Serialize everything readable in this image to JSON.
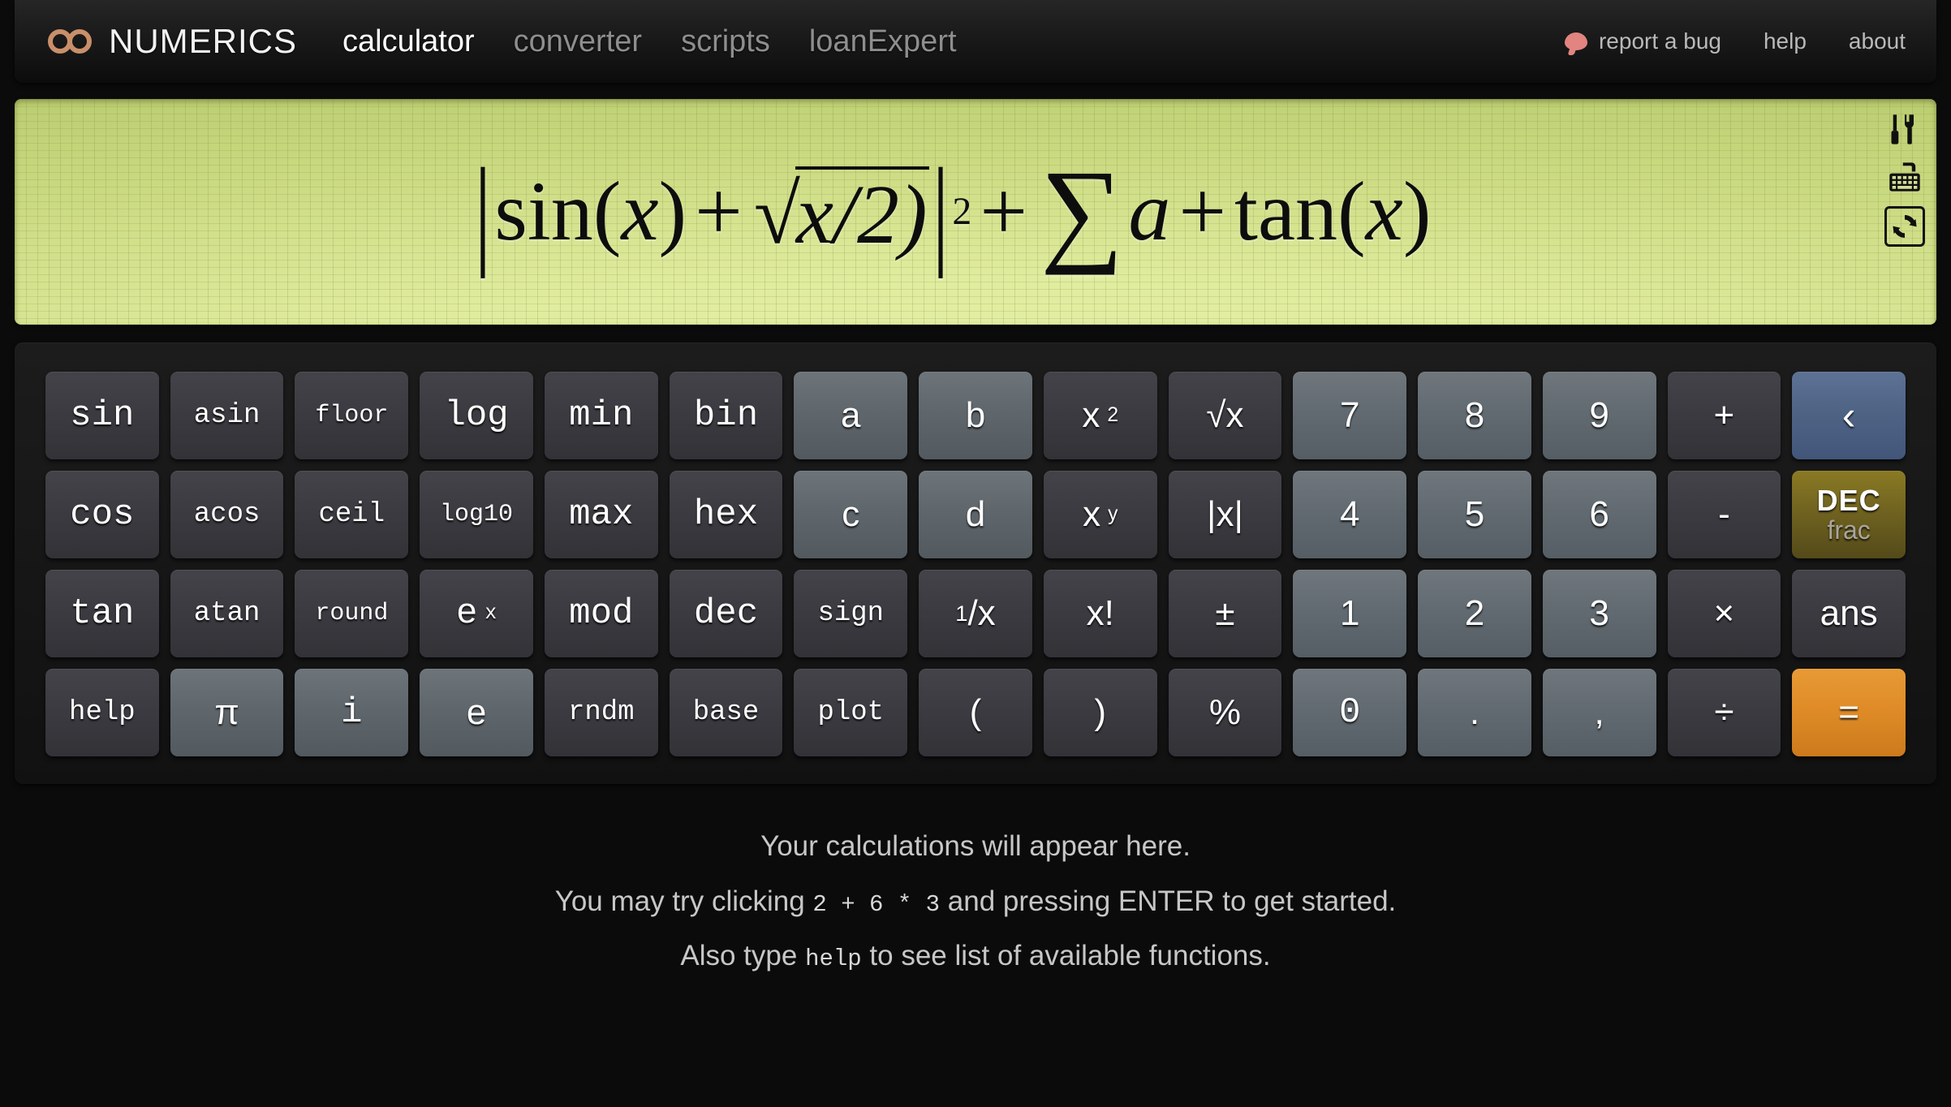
{
  "header": {
    "brand": "NUMERICS",
    "brand_icon": "infinity-icon",
    "brand_color": "#c98f6a",
    "nav": [
      {
        "label": "calculator",
        "active": true
      },
      {
        "label": "converter",
        "active": false
      },
      {
        "label": "scripts",
        "active": false
      },
      {
        "label": "loanExpert",
        "active": false
      }
    ],
    "util": [
      {
        "label": "report a bug",
        "icon": "speech-bubble-icon",
        "icon_color": "#e2847f"
      },
      {
        "label": "help",
        "icon": null
      },
      {
        "label": "about",
        "icon": null
      }
    ]
  },
  "display": {
    "background_color": "#d5e28f",
    "text_color": "#0d0d0d",
    "expression_plain": "|sin(x) + √x/2)|² + ∑a + tan(x)",
    "tokens": {
      "bar_open": "|",
      "sin": "sin",
      "paren_open": "(",
      "var_x": "x",
      "paren_close": ")",
      "plus": "+",
      "sqrt_sign": "√",
      "sqrt_body": "x/2)",
      "bar_close": "|",
      "exponent": "2",
      "plus2": "+",
      "sigma": "∑",
      "var_a": "a",
      "plus3": "+",
      "tan": "tan",
      "paren_open2": "(",
      "var_x2": "x",
      "paren_close2": ")"
    },
    "tools": [
      {
        "name": "settings-tools-icon",
        "title": "settings"
      },
      {
        "name": "keyboard-icon",
        "title": "keyboard"
      },
      {
        "name": "refresh-icon",
        "title": "refresh",
        "boxed": true
      }
    ]
  },
  "keypad": {
    "rows": [
      [
        {
          "label": "sin",
          "type": "fn",
          "size": "lg"
        },
        {
          "label": "asin",
          "type": "fn",
          "size": "md"
        },
        {
          "label": "floor",
          "type": "fn",
          "size": "sm"
        },
        {
          "label": "log",
          "type": "fn",
          "size": "lg"
        },
        {
          "label": "min",
          "type": "fn",
          "size": "lg"
        },
        {
          "label": "bin",
          "type": "fn",
          "size": "lg"
        },
        {
          "label": "a",
          "type": "var",
          "size": "lg",
          "sans": true
        },
        {
          "label": "b",
          "type": "var",
          "size": "lg",
          "sans": true
        },
        {
          "label": "x",
          "sup": "2",
          "type": "op",
          "size": "lg",
          "sans": true,
          "name": "x-squared"
        },
        {
          "label": "√x",
          "type": "op",
          "size": "lg",
          "sans": true,
          "name": "square-root"
        },
        {
          "label": "7",
          "type": "num",
          "size": "lg",
          "sans": true
        },
        {
          "label": "8",
          "type": "num",
          "size": "lg",
          "sans": true
        },
        {
          "label": "9",
          "type": "num",
          "size": "lg",
          "sans": true
        },
        {
          "label": "+",
          "type": "op",
          "size": "lg",
          "sans": true
        },
        {
          "label": "‹",
          "type": "back",
          "size": "xl",
          "sans": true,
          "name": "backspace"
        }
      ],
      [
        {
          "label": "cos",
          "type": "fn",
          "size": "lg"
        },
        {
          "label": "acos",
          "type": "fn",
          "size": "md"
        },
        {
          "label": "ceil",
          "type": "fn",
          "size": "md"
        },
        {
          "label": "log10",
          "type": "fn",
          "size": "sm"
        },
        {
          "label": "max",
          "type": "fn",
          "size": "lg"
        },
        {
          "label": "hex",
          "type": "fn",
          "size": "lg"
        },
        {
          "label": "c",
          "type": "var",
          "size": "lg",
          "sans": true
        },
        {
          "label": "d",
          "type": "var",
          "size": "lg",
          "sans": true
        },
        {
          "label": "x",
          "sup": "y",
          "type": "op",
          "size": "lg",
          "sans": true,
          "name": "x-power-y"
        },
        {
          "label": "|x|",
          "type": "op",
          "size": "lg",
          "sans": true,
          "name": "absolute-value"
        },
        {
          "label": "4",
          "type": "num",
          "size": "lg",
          "sans": true
        },
        {
          "label": "5",
          "type": "num",
          "size": "lg",
          "sans": true
        },
        {
          "label": "6",
          "type": "num",
          "size": "lg",
          "sans": true
        },
        {
          "label": "-",
          "type": "op",
          "size": "lg",
          "sans": true
        },
        {
          "top": "DEC",
          "bottom": "frac",
          "type": "mode",
          "name": "dec-frac-toggle"
        }
      ],
      [
        {
          "label": "tan",
          "type": "fn",
          "size": "lg"
        },
        {
          "label": "atan",
          "type": "fn",
          "size": "md"
        },
        {
          "label": "round",
          "type": "fn",
          "size": "sm"
        },
        {
          "label": "e",
          "sup": "x",
          "type": "fn",
          "size": "lg",
          "name": "e-power-x"
        },
        {
          "label": "mod",
          "type": "fn",
          "size": "lg"
        },
        {
          "label": "dec",
          "type": "fn",
          "size": "lg"
        },
        {
          "label": "sign",
          "type": "fn",
          "size": "md"
        },
        {
          "pre": "1",
          "label": "/x",
          "type": "op",
          "size": "lg",
          "sans": true,
          "name": "reciprocal"
        },
        {
          "label": "x!",
          "type": "op",
          "size": "lg",
          "sans": true,
          "name": "factorial"
        },
        {
          "label": "±",
          "type": "op",
          "size": "lg",
          "sans": true,
          "name": "plus-minus"
        },
        {
          "label": "1",
          "type": "num",
          "size": "lg",
          "sans": true
        },
        {
          "label": "2",
          "type": "num",
          "size": "lg",
          "sans": true
        },
        {
          "label": "3",
          "type": "num",
          "size": "lg",
          "sans": true
        },
        {
          "label": "×",
          "type": "op",
          "size": "lg",
          "sans": true,
          "name": "multiply"
        },
        {
          "label": "ans",
          "type": "ans",
          "size": "lg",
          "sans": true
        }
      ],
      [
        {
          "label": "help",
          "type": "fn",
          "size": "md"
        },
        {
          "label": "π",
          "type": "var",
          "size": "lg",
          "sans": true,
          "name": "pi"
        },
        {
          "label": "i",
          "type": "var",
          "size": "lg"
        },
        {
          "label": "e",
          "type": "var",
          "size": "lg",
          "sans": true
        },
        {
          "label": "rndm",
          "type": "fn",
          "size": "md"
        },
        {
          "label": "base",
          "type": "fn",
          "size": "md"
        },
        {
          "label": "plot",
          "type": "fn",
          "size": "md"
        },
        {
          "label": "(",
          "type": "op",
          "size": "lg",
          "sans": true,
          "name": "paren-open"
        },
        {
          "label": ")",
          "type": "op",
          "size": "lg",
          "sans": true,
          "name": "paren-close"
        },
        {
          "label": "%",
          "type": "op",
          "size": "lg",
          "sans": true,
          "name": "percent"
        },
        {
          "label": "0",
          "type": "num",
          "size": "lg"
        },
        {
          "label": ".",
          "type": "num",
          "size": "lg",
          "sans": true,
          "name": "decimal-point"
        },
        {
          "label": ",",
          "type": "num",
          "size": "lg",
          "sans": true,
          "name": "comma"
        },
        {
          "label": "÷",
          "type": "op",
          "size": "lg",
          "sans": true,
          "name": "divide"
        },
        {
          "label": "=",
          "type": "eq",
          "size": "lg",
          "sans": true,
          "name": "equals"
        }
      ]
    ]
  },
  "output": {
    "line1": "Your calculations will appear here.",
    "line2_pre": "You may try clicking ",
    "line2_code": "2 + 6 * 3",
    "line2_post": " and pressing ENTER to get started.",
    "line3_pre": "Also type ",
    "line3_code": "help",
    "line3_post": " to see list of available functions."
  }
}
